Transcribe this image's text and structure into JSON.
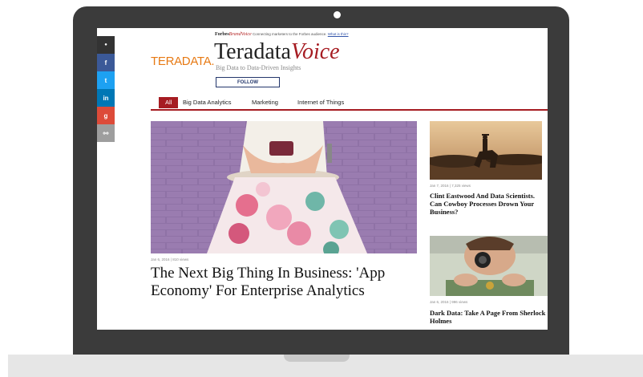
{
  "brandvoice": {
    "forbes": "Forbes",
    "brand": "BrandVoice",
    "tagline": "Connecting marketers to the Forbes audience.",
    "link": "What is this?"
  },
  "share_icons": [
    {
      "icon": "comment-icon",
      "glyph": "●",
      "color": "#333333"
    },
    {
      "icon": "facebook-icon",
      "glyph": "f",
      "color": "#3b5998"
    },
    {
      "icon": "twitter-icon",
      "glyph": "t",
      "color": "#1da1f2"
    },
    {
      "icon": "linkedin-icon",
      "glyph": "in",
      "color": "#0077b5"
    },
    {
      "icon": "google-plus-icon",
      "glyph": "g",
      "color": "#dd4b39"
    },
    {
      "icon": "link-icon",
      "glyph": "⚯",
      "color": "#9e9e9e"
    }
  ],
  "logo": "TERADATA.",
  "voice_title": {
    "main": "Teradata",
    "italic": "Voice"
  },
  "voice_subtitle": "Big Data to Data-Driven Insights",
  "follow_label": "FOLLOW",
  "nav": {
    "items": [
      "All",
      "Big Data Analytics",
      "Marketing",
      "Internet of Things"
    ],
    "active": "All",
    "accent": "#a61c22"
  },
  "main_article": {
    "meta": "Jan 6, 2016 | 810 views",
    "headline": "The Next Big Thing In Business: 'App Economy' For Enterprise Analytics"
  },
  "side_articles": [
    {
      "meta": "Jan 7, 2016 | 7,325 views",
      "headline": "Clint Eastwood And Data Scientists. Can Cowboy Processes Drown Your Business?"
    },
    {
      "meta": "Jan 6, 2016 | 996 views",
      "headline": "Dark Data: Take A Page From Sherlock Holmes"
    }
  ]
}
